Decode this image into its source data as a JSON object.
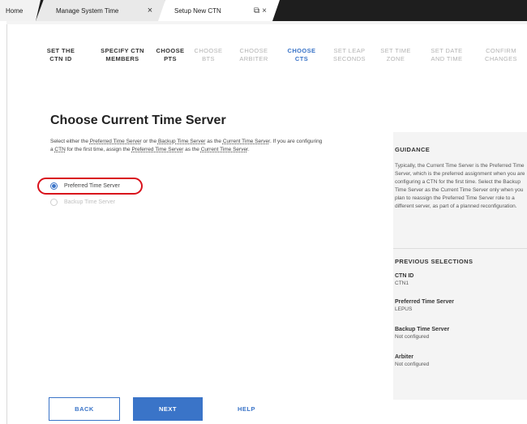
{
  "tabs": {
    "home": "Home",
    "manage_system_time": "Manage System Time",
    "setup_new_ctn": "Setup New CTN",
    "close_glyph": "×",
    "restore_glyph": "⧉"
  },
  "wizard": {
    "steps": [
      {
        "label": "SET THE CTN ID",
        "state": "done"
      },
      {
        "label": "SPECIFY CTN MEMBERS",
        "state": "done"
      },
      {
        "label": "CHOOSE PTS",
        "state": "done"
      },
      {
        "label": "CHOOSE BTS",
        "state": "pending"
      },
      {
        "label": "CHOOSE ARBITER",
        "state": "pending"
      },
      {
        "label": "CHOOSE CTS",
        "state": "active"
      },
      {
        "label": "SET LEAP SECONDS",
        "state": "pending"
      },
      {
        "label": "SET TIME ZONE",
        "state": "pending"
      },
      {
        "label": "SET DATE AND TIME",
        "state": "pending"
      },
      {
        "label": "CONFIRM CHANGES",
        "state": "pending"
      }
    ]
  },
  "main": {
    "title": "Choose Current Time Server",
    "desc": {
      "p1": "Select either the ",
      "pts1": "Preferred Time Server",
      "p2": " or the ",
      "bts": "Backup Time Server",
      "p3": " as the ",
      "cts1": "Current Time Server",
      "p4": ". If you are configuring a ",
      "ctn": "CTN",
      "p5": " for the first time, assign the ",
      "pts2": "Preferred Time Server",
      "p6": " as the ",
      "cts2": "Current Time Server",
      "p7": "."
    },
    "options": [
      {
        "label": "Preferred Time Server",
        "selected": true,
        "enabled": true
      },
      {
        "label": "Backup Time Server",
        "selected": false,
        "enabled": false
      }
    ]
  },
  "sidebar": {
    "guidance_heading": "GUIDANCE",
    "guidance_text": "Typically, the Current Time Server is the Preferred Time Server, which is the preferred assignment when you are configuring a CTN for the first time. Select the Backup Time Server as the Current Time Server only when you plan to reassign the Preferred Time Server role to a different server, as part of a planned reconfiguration.",
    "previous_heading": "PREVIOUS SELECTIONS",
    "previous": [
      {
        "key": "CTN ID",
        "value": "CTN1"
      },
      {
        "key": "Preferred Time Server",
        "value": "LEPUS"
      },
      {
        "key": "Backup Time Server",
        "value": "Not configured"
      },
      {
        "key": "Arbiter",
        "value": "Not configured"
      }
    ]
  },
  "footer": {
    "back": "BACK",
    "next": "NEXT",
    "help": "HELP"
  },
  "colors": {
    "accent": "#3a74c8",
    "highlight": "#d9111b",
    "tabbar": "#1e1e1e"
  }
}
